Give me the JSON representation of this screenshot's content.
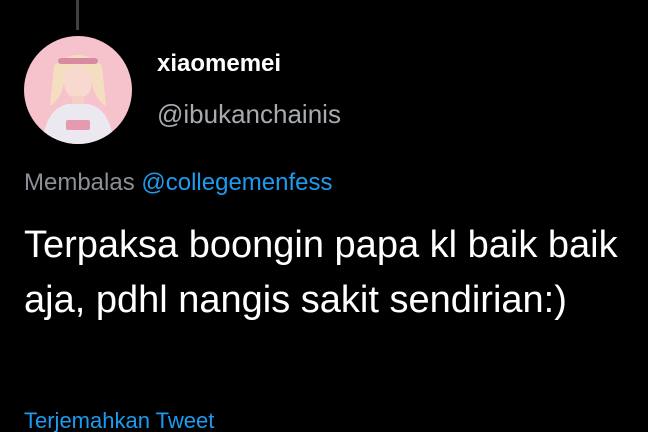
{
  "tweet": {
    "author": {
      "display_name": "xiaomemei",
      "handle": "@ibukanchainis",
      "avatar_icon": "profile-photo"
    },
    "reply": {
      "label": "Membalas",
      "target": "@collegemenfess"
    },
    "text": "Terpaksa boongin papa kl baik baik aja, pdhl nangis sakit sendirian:)",
    "translate_label": "Terjemahkan Tweet"
  },
  "colors": {
    "background": "#000000",
    "text_primary": "#ffffff",
    "text_secondary": "#a7abb0",
    "accent": "#1d9bf0"
  }
}
